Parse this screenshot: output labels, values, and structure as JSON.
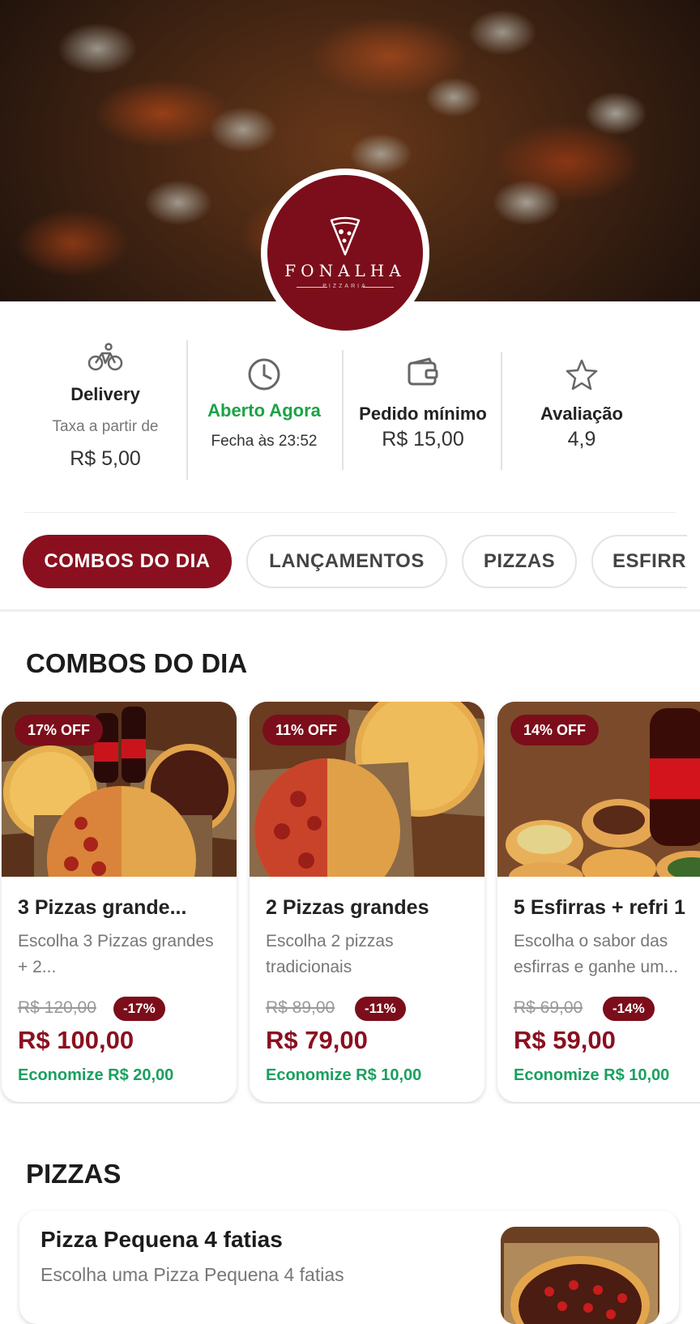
{
  "store": {
    "logo_name": "FONALHA",
    "logo_sub": "PIZZARIA"
  },
  "info": {
    "delivery": {
      "icon": "bike-icon",
      "title": "Delivery",
      "sub": "Taxa a partir de",
      "value": "R$ 5,00"
    },
    "hours": {
      "icon": "clock-icon",
      "title": "Aberto Agora",
      "sub": "Fecha às 23:52"
    },
    "minimum": {
      "icon": "wallet-icon",
      "title": "Pedido mínimo",
      "value": "R$ 15,00"
    },
    "rating": {
      "icon": "star-icon",
      "title": "Avaliação",
      "value": "4,9"
    }
  },
  "tabs": [
    {
      "label": "COMBOS DO DIA",
      "active": true
    },
    {
      "label": "LANÇAMENTOS",
      "active": false
    },
    {
      "label": "PIZZAS",
      "active": false
    },
    {
      "label": "ESFIRRAS",
      "active": false
    }
  ],
  "combos": {
    "title": "COMBOS DO DIA",
    "items": [
      {
        "badge": "17% OFF",
        "name": "3 Pizzas grande...",
        "desc": "Escolha 3 Pizzas grandes + 2...",
        "old_price": "R$ 120,00",
        "discount": "-17%",
        "price": "R$ 100,00",
        "saving": "Economize R$ 20,00"
      },
      {
        "badge": "11% OFF",
        "name": "2 Pizzas grandes",
        "desc": "Escolha 2 pizzas tradicionais",
        "old_price": "R$ 89,00",
        "discount": "-11%",
        "price": "R$ 79,00",
        "saving": "Economize R$ 10,00"
      },
      {
        "badge": "14% OFF",
        "name": "5 Esfirras + refri 1",
        "desc": "Escolha o sabor das esfirras e ganhe um...",
        "old_price": "R$ 69,00",
        "discount": "-14%",
        "price": "R$ 59,00",
        "saving": "Economize R$ 10,00"
      }
    ]
  },
  "pizzas": {
    "title": "PIZZAS",
    "items": [
      {
        "name": "Pizza Pequena 4 fatias",
        "desc": "Escolha uma Pizza Pequena 4 fatias"
      }
    ]
  },
  "colors": {
    "brand": "#7b0e1a",
    "accent_green": "#1aa345"
  }
}
